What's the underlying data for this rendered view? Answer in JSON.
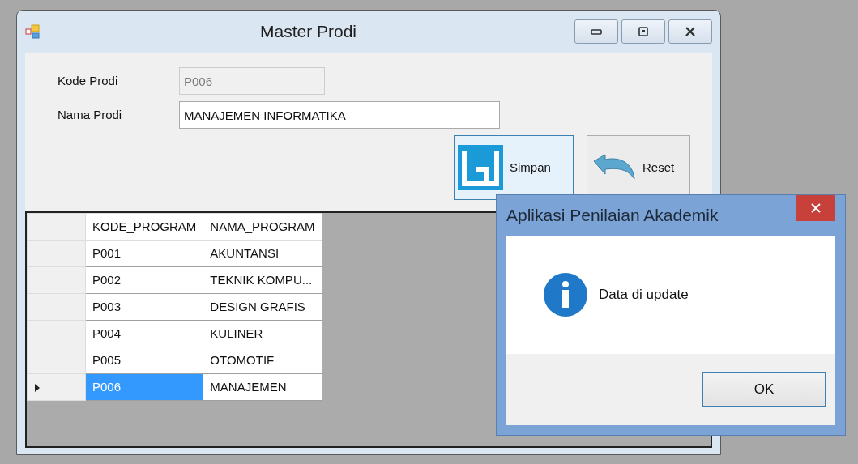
{
  "window": {
    "title": "Master Prodi"
  },
  "form": {
    "fields": [
      {
        "label": "Kode Prodi",
        "value": "P006",
        "disabled": true
      },
      {
        "label": "Nama Prodi",
        "value": "MANAJEMEN INFORMATIKA",
        "disabled": false
      }
    ],
    "buttons": [
      {
        "label": "Simpan",
        "kind": "save"
      },
      {
        "label": "Reset",
        "kind": "reset"
      }
    ]
  },
  "grid": {
    "columns": [
      "KODE_PROGRAM",
      "NAMA_PROGRAM"
    ],
    "rows": [
      {
        "cells": [
          "P001",
          "AKUNTANSI"
        ],
        "selected": false
      },
      {
        "cells": [
          "P002",
          "TEKNIK KOMPU..."
        ],
        "selected": false
      },
      {
        "cells": [
          "P003",
          "DESIGN GRAFIS"
        ],
        "selected": false
      },
      {
        "cells": [
          "P004",
          "KULINER"
        ],
        "selected": false
      },
      {
        "cells": [
          "P005",
          "OTOMOTIF"
        ],
        "selected": false
      },
      {
        "cells": [
          "P006",
          "MANAJEMEN"
        ],
        "selected": true
      }
    ]
  },
  "dialog": {
    "title": "Aplikasi Penilaian Akademik",
    "message": "Data di update",
    "button": "OK"
  }
}
